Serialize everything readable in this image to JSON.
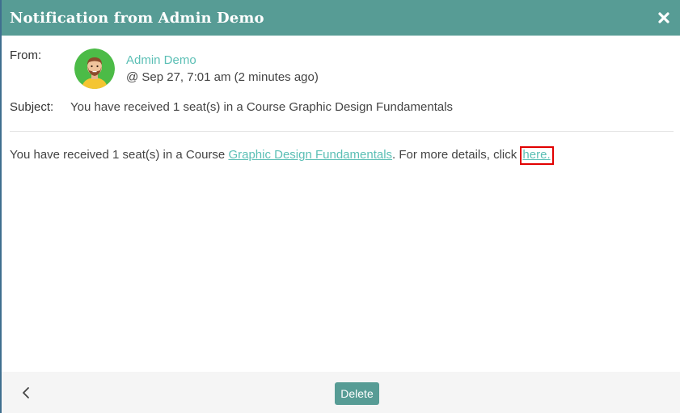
{
  "header": {
    "title": "Notification from Admin Demo",
    "close_icon": "close-icon"
  },
  "from": {
    "label": "From:",
    "sender_name": "Admin Demo",
    "timestamp": "@ Sep 27, 7:01 am (2 minutes ago)",
    "avatar_icon": "user-avatar-icon"
  },
  "subject": {
    "label": "Subject:",
    "text": "You have received 1 seat(s) in a Course Graphic Design Fundamentals"
  },
  "message": {
    "prefix": "You have received 1 seat(s) in a Course ",
    "course_link": "Graphic Design Fundamentals",
    "middle": ". For more details, click ",
    "here_link": "here."
  },
  "footer": {
    "back_icon": "chevron-left-icon",
    "delete_label": "Delete"
  },
  "colors": {
    "header_bg": "#579c95",
    "link": "#5bbfb5",
    "highlight": "#e10000",
    "footer_bg": "#f5f5f5"
  }
}
